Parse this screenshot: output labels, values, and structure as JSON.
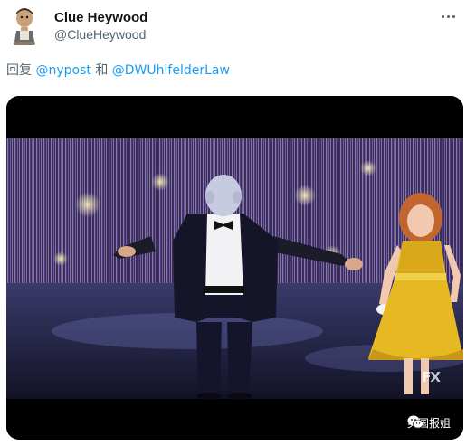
{
  "author": {
    "display_name": "Clue Heywood",
    "handle": "@ClueHeywood"
  },
  "reply_line": {
    "prefix": "回复",
    "mention_1": "@nypost",
    "connector": "和",
    "mention_2": "@DWUhlfelderLaw"
  },
  "media": {
    "channel_logo": "FX",
    "watermark_text": "英国报姐",
    "watermark_icon": "wechat-icon"
  },
  "colors": {
    "accent": "#1d9bf0",
    "secondary_text": "#536471",
    "primary_text": "#0f1419"
  }
}
